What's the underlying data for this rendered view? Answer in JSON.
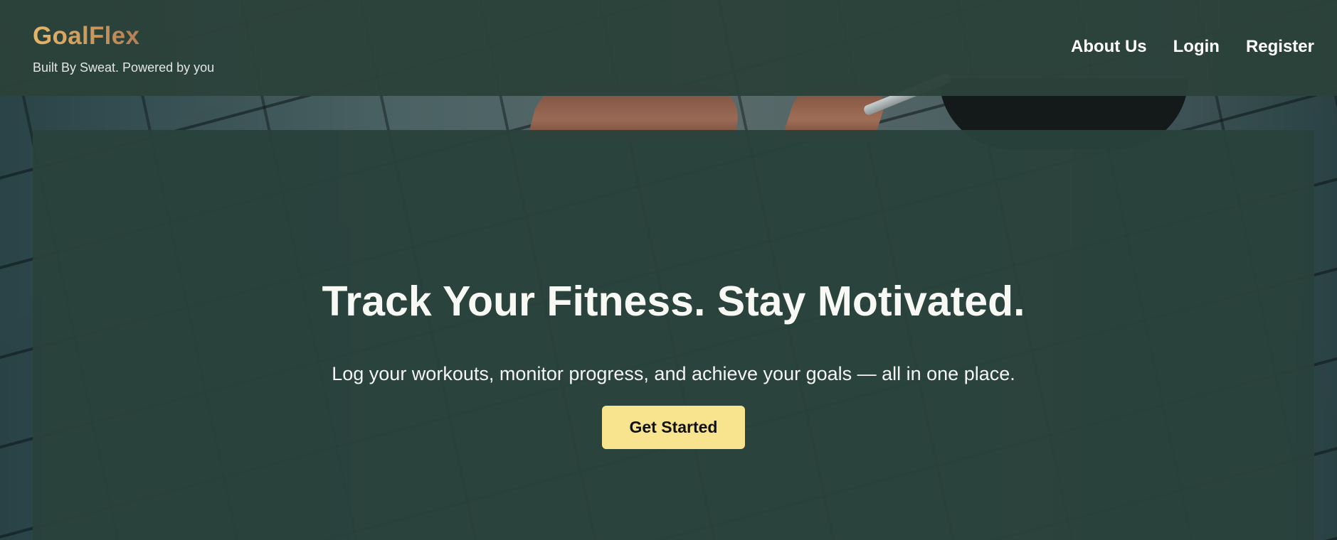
{
  "header": {
    "brand": "GoalFlex",
    "tagline": "Built By Sweat. Powered by you",
    "nav": [
      {
        "label": "About Us"
      },
      {
        "label": "Login"
      },
      {
        "label": "Register"
      }
    ]
  },
  "hero": {
    "heading": "Track Your Fitness. Stay Motivated.",
    "subheading": "Log your workouts, monitor progress, and achieve your goals — all in one place.",
    "cta_label": "Get Started"
  },
  "colors": {
    "header_bg": "#2b423b",
    "brand_gold": "#d4a460",
    "cta_bg": "#f8e38f",
    "text_light": "#ffffff"
  }
}
